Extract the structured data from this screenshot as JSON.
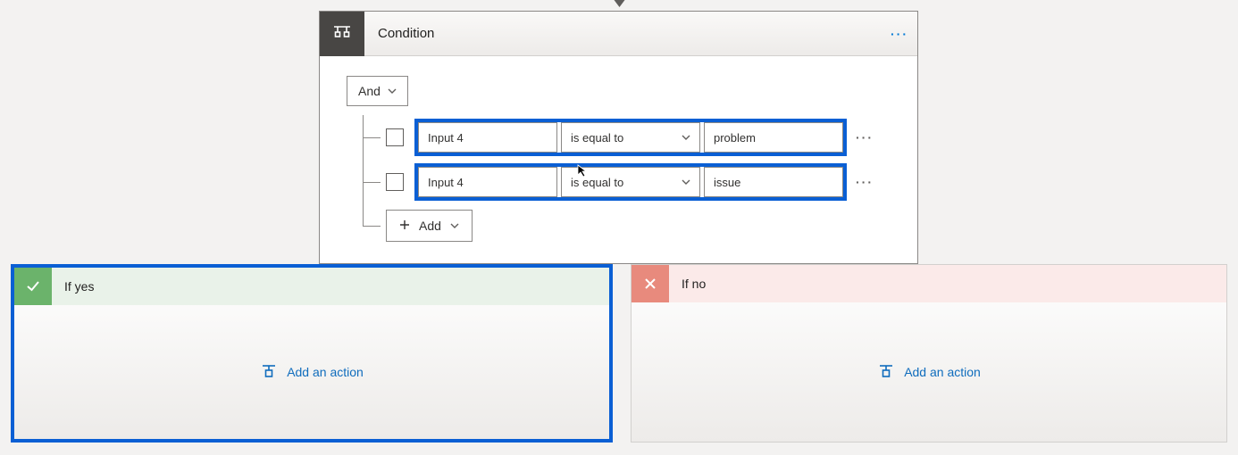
{
  "condition": {
    "title": "Condition",
    "group_operator": "And",
    "rows": [
      {
        "field": "Input 4",
        "operator": "is equal to",
        "value": "problem"
      },
      {
        "field": "Input 4",
        "operator": "is equal to",
        "value": "issue"
      }
    ],
    "add_label": "Add"
  },
  "branches": {
    "yes": {
      "title": "If yes",
      "action_label": "Add an action"
    },
    "no": {
      "title": "If no",
      "action_label": "Add an action"
    }
  }
}
